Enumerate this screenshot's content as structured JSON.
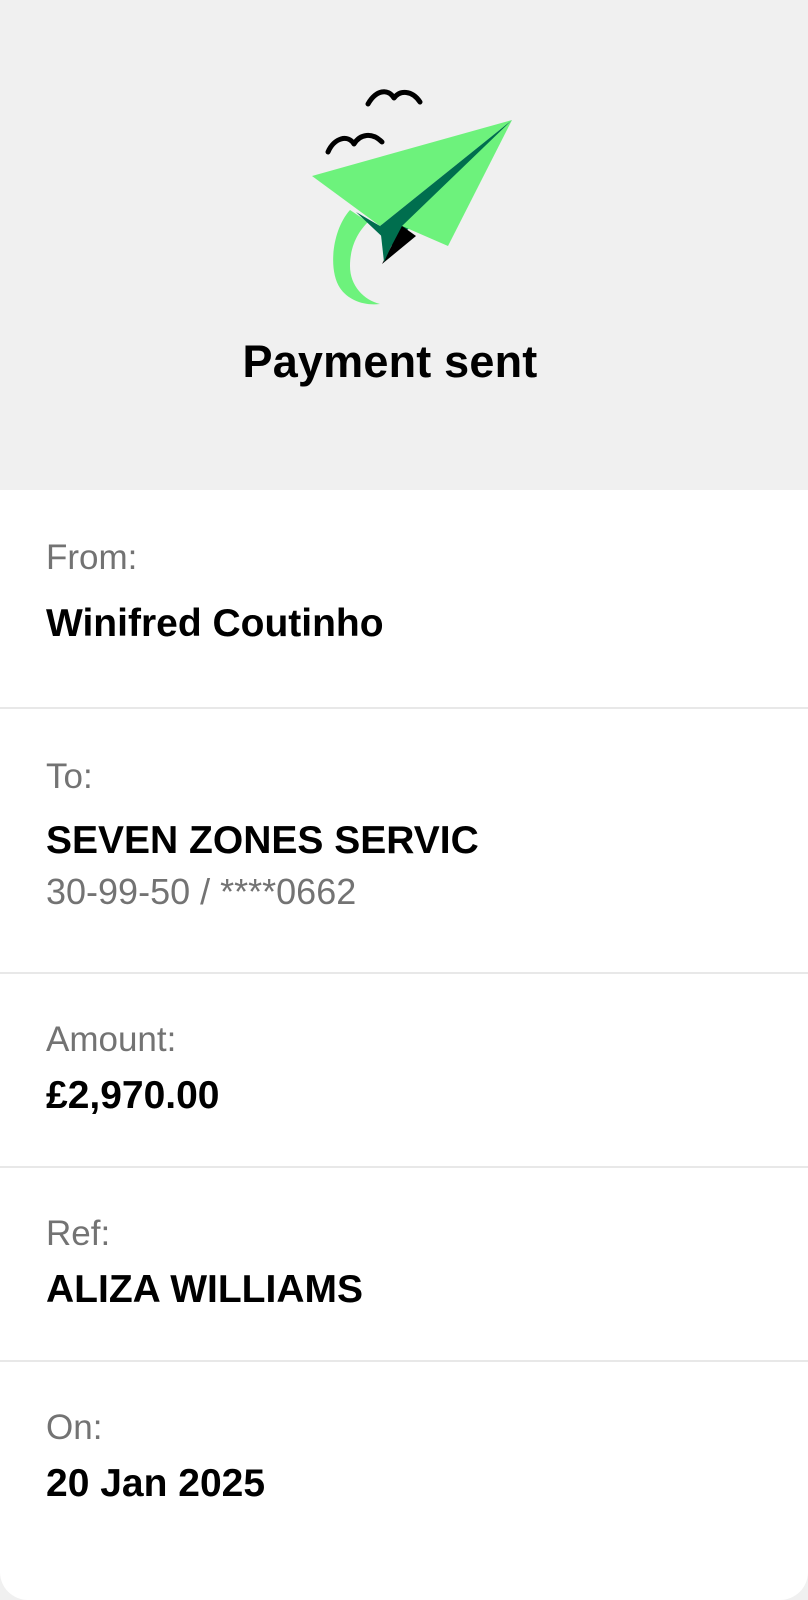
{
  "header": {
    "title": "Payment sent",
    "illustration_icon": "paper-plane-with-birds-icon",
    "colors": {
      "plane_light": "#6df27c",
      "plane_dark": "#006e4e"
    }
  },
  "details": {
    "from": {
      "label": "From:",
      "value": "Winifred Coutinho"
    },
    "to": {
      "label": "To:",
      "value": "SEVEN ZONES SERVIC",
      "account": "30-99-50 / ****0662"
    },
    "amount": {
      "label": "Amount:",
      "value": "£2,970.00"
    },
    "ref": {
      "label": "Ref:",
      "value": "ALIZA WILLIAMS"
    },
    "on": {
      "label": "On:",
      "value": "20 Jan 2025"
    }
  }
}
